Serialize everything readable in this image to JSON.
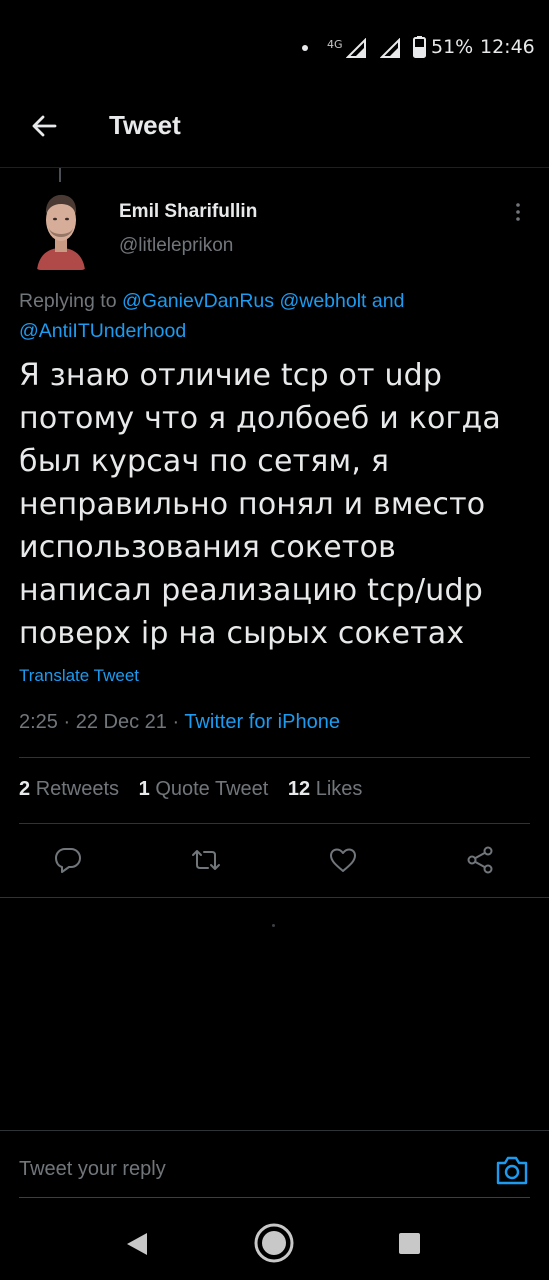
{
  "status_bar": {
    "network": "4G",
    "battery": "51%",
    "time": "12:46",
    "icons": [
      "notification-dot-icon",
      "signal-icon",
      "signal-icon",
      "battery-icon"
    ]
  },
  "header": {
    "title": "Tweet",
    "back_icon": "arrow-left-icon"
  },
  "tweet": {
    "author_name": "Emil Sharifullin",
    "author_handle": "@litleleprikon",
    "replying_prefix": "Replying to",
    "mentions": [
      "@GanievDanRus",
      "@webholt",
      "@AntiITUnderhood"
    ],
    "mentions_joiner": "and",
    "text": "Я знаю отличие tcp от udp\nпотому что я долбоеб и когда\nбыл курсач по сетям, я\nнеправильно понял и вместо\nиспользования сокетов\nнаписал реализацию tcp/udp\nповерх ip на сырых сокетах",
    "translate_label": "Translate Tweet",
    "time": "2:25",
    "date": "22 Dec 21",
    "source": "Twitter for iPhone"
  },
  "stats": {
    "retweets_count": "2",
    "retweets_label": "Retweets",
    "quotes_count": "1",
    "quotes_label": "Quote Tweet",
    "likes_count": "12",
    "likes_label": "Likes"
  },
  "actions": [
    "reply-icon",
    "retweet-icon",
    "like-icon",
    "share-icon"
  ],
  "reply_bar": {
    "placeholder": "Tweet your reply",
    "camera_icon": "camera-icon"
  },
  "nav_bar": [
    "back-triangle-icon",
    "home-circle-icon",
    "recents-square-icon"
  ],
  "colors": {
    "background": "#000000",
    "text": "#e7e9ea",
    "secondary": "#71767b",
    "accent": "#1d9bf0",
    "divider": "#2f3336"
  }
}
